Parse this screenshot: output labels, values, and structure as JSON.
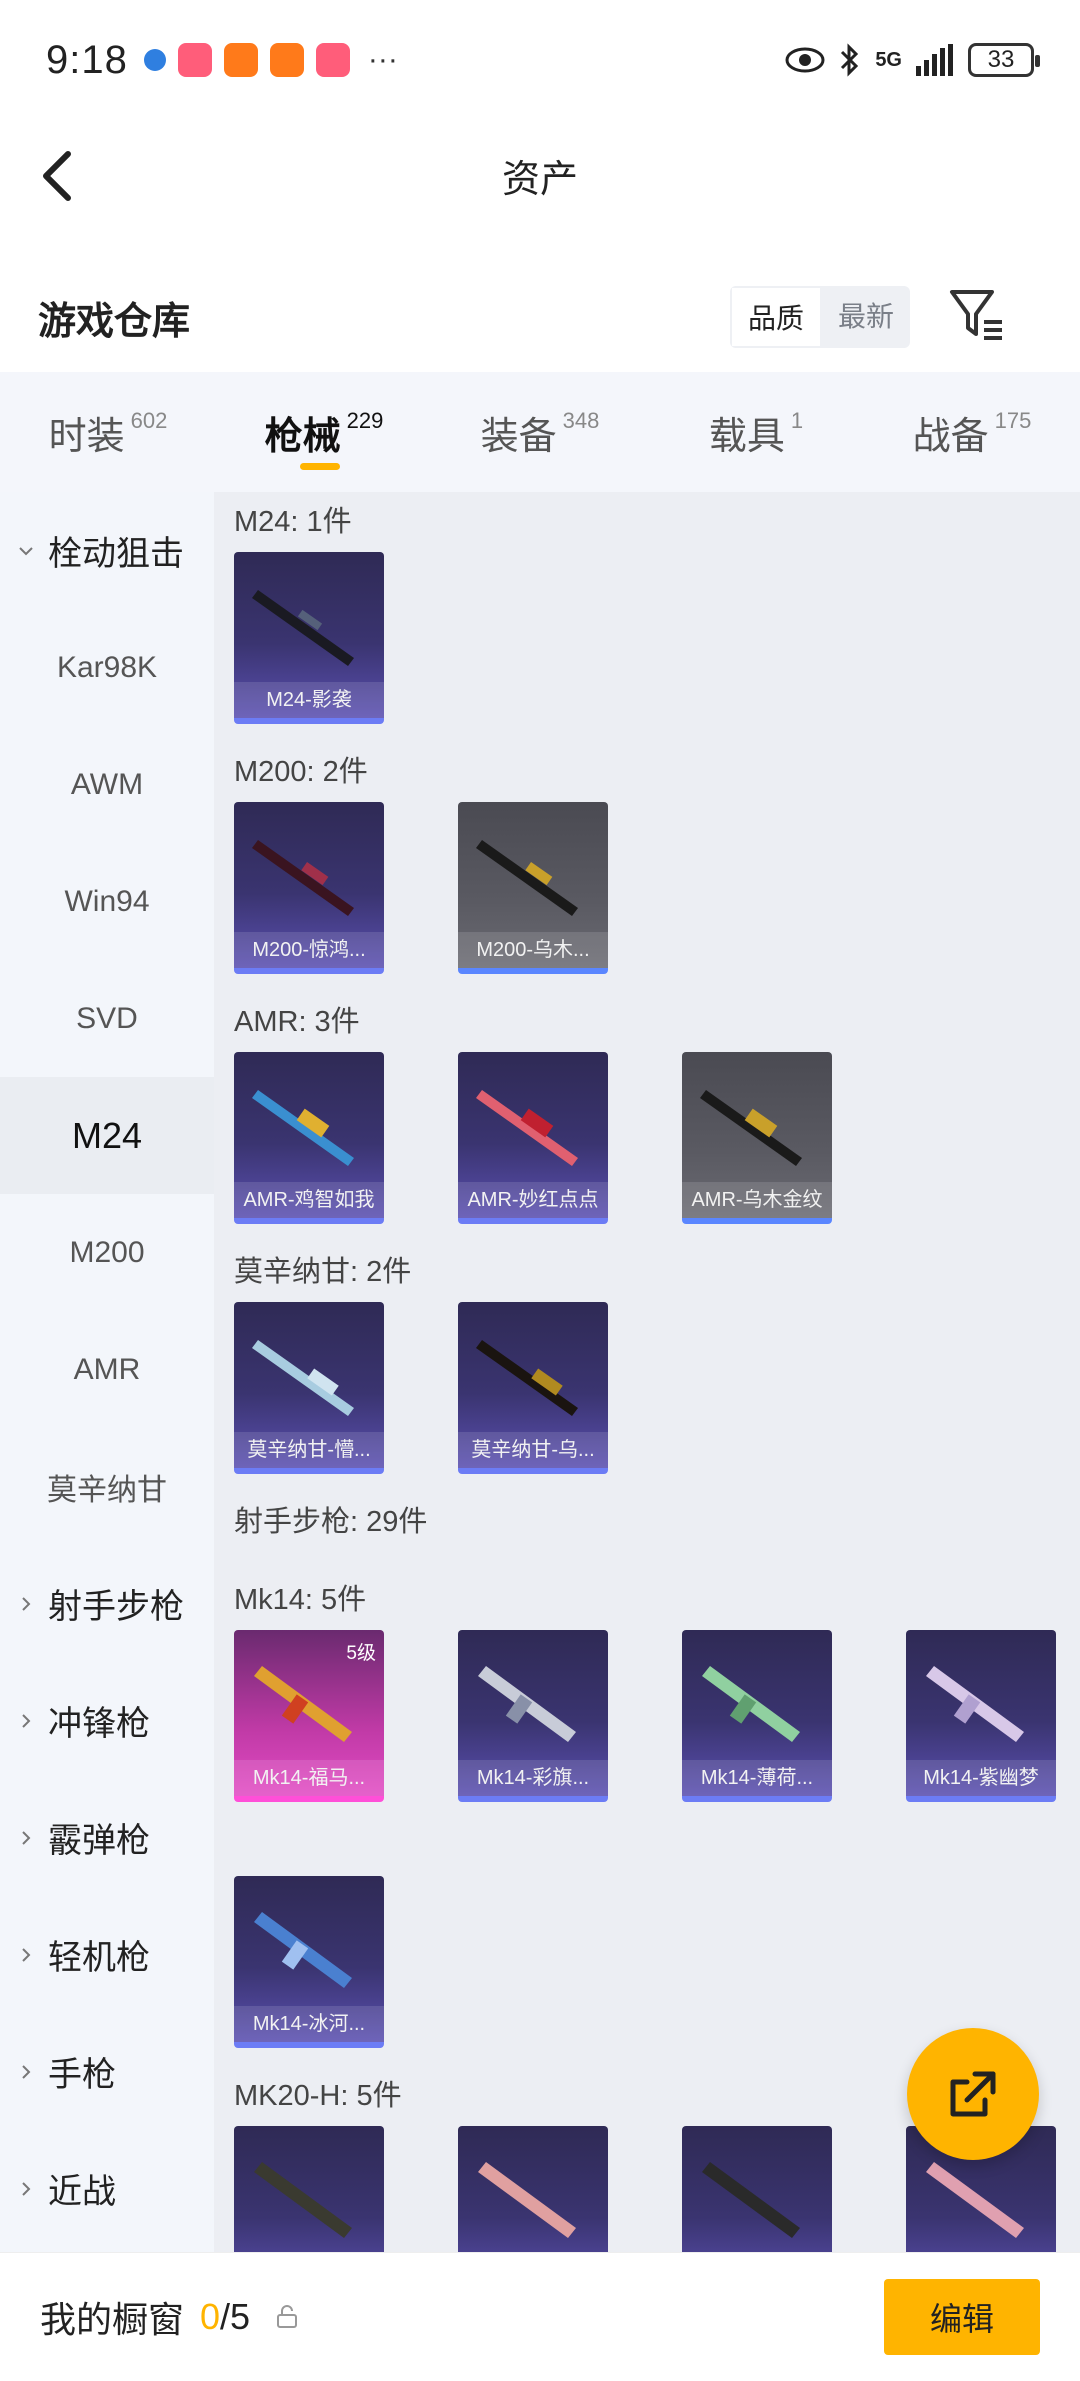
{
  "status_bar": {
    "time": "9:18",
    "battery": "33",
    "network": "5G",
    "more": "···"
  },
  "header": {
    "title": "资产"
  },
  "warehouse": {
    "title": "游戏仓库",
    "sort_quality": "品质",
    "sort_latest": "最新"
  },
  "tabs": [
    {
      "label": "时装",
      "count": "602"
    },
    {
      "label": "枪械",
      "count": "229"
    },
    {
      "label": "装备",
      "count": "348"
    },
    {
      "label": "载具",
      "count": "1"
    },
    {
      "label": "战备",
      "count": "175"
    }
  ],
  "sidebar": {
    "items": [
      {
        "label": "栓动狙击"
      },
      {
        "label": "Kar98K"
      },
      {
        "label": "AWM"
      },
      {
        "label": "Win94"
      },
      {
        "label": "SVD"
      },
      {
        "label": "M24"
      },
      {
        "label": "M200"
      },
      {
        "label": "AMR"
      },
      {
        "label": "莫辛纳甘"
      },
      {
        "label": "射手步枪"
      },
      {
        "label": "冲锋枪"
      },
      {
        "label": "霰弹枪"
      },
      {
        "label": "轻机枪"
      },
      {
        "label": "手枪"
      },
      {
        "label": "近战"
      }
    ]
  },
  "sections": {
    "m24": {
      "label": "M24: 1件",
      "items": [
        "M24-影袭"
      ]
    },
    "m200": {
      "label": "M200: 2件",
      "items": [
        "M200-惊鸿...",
        "M200-乌木..."
      ]
    },
    "amr": {
      "label": "AMR: 3件",
      "items": [
        "AMR-鸡智如我",
        "AMR-妙红点点",
        "AMR-乌木金纹"
      ]
    },
    "mosin": {
      "label": "莫辛纳甘: 2件",
      "items": [
        "莫辛纳甘-懵...",
        "莫辛纳甘-乌..."
      ]
    },
    "marksman": {
      "label": "射手步枪: 29件"
    },
    "mk14": {
      "label": "Mk14: 5件",
      "badge": "5级",
      "items": [
        "Mk14-福马...",
        "Mk14-彩旗...",
        "Mk14-薄荷...",
        "Mk14-紫幽梦",
        "Mk14-冰河..."
      ]
    },
    "mk20": {
      "label": "MK20-H: 5件"
    }
  },
  "bottom_bar": {
    "label": "我的橱窗",
    "count_current": "0",
    "count_total": "/5",
    "edit_label": "编辑"
  },
  "colors": {
    "accent": "#ffb400",
    "card_purple": "#3a3470",
    "card_gray": "#55555c",
    "card_pink": "#c03aa6"
  }
}
